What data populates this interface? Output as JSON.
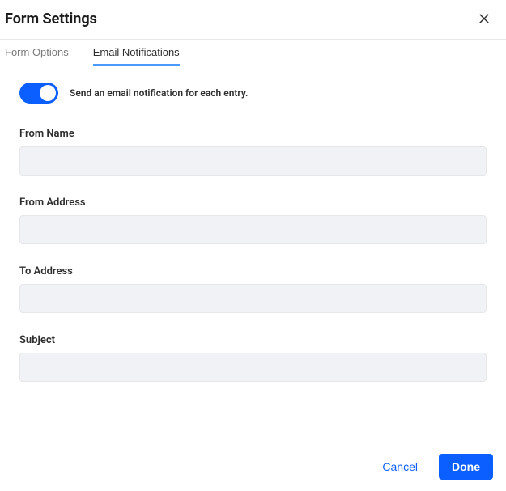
{
  "header": {
    "title": "Form Settings"
  },
  "tabs": {
    "form_options": "Form Options",
    "email_notifications": "Email Notifications"
  },
  "toggle": {
    "label": "Send an email notification for each entry."
  },
  "fields": {
    "from_name": {
      "label": "From Name",
      "value": ""
    },
    "from_address": {
      "label": "From Address",
      "value": ""
    },
    "to_address": {
      "label": "To Address",
      "value": ""
    },
    "subject": {
      "label": "Subject",
      "value": ""
    }
  },
  "footer": {
    "cancel": "Cancel",
    "done": "Done"
  }
}
